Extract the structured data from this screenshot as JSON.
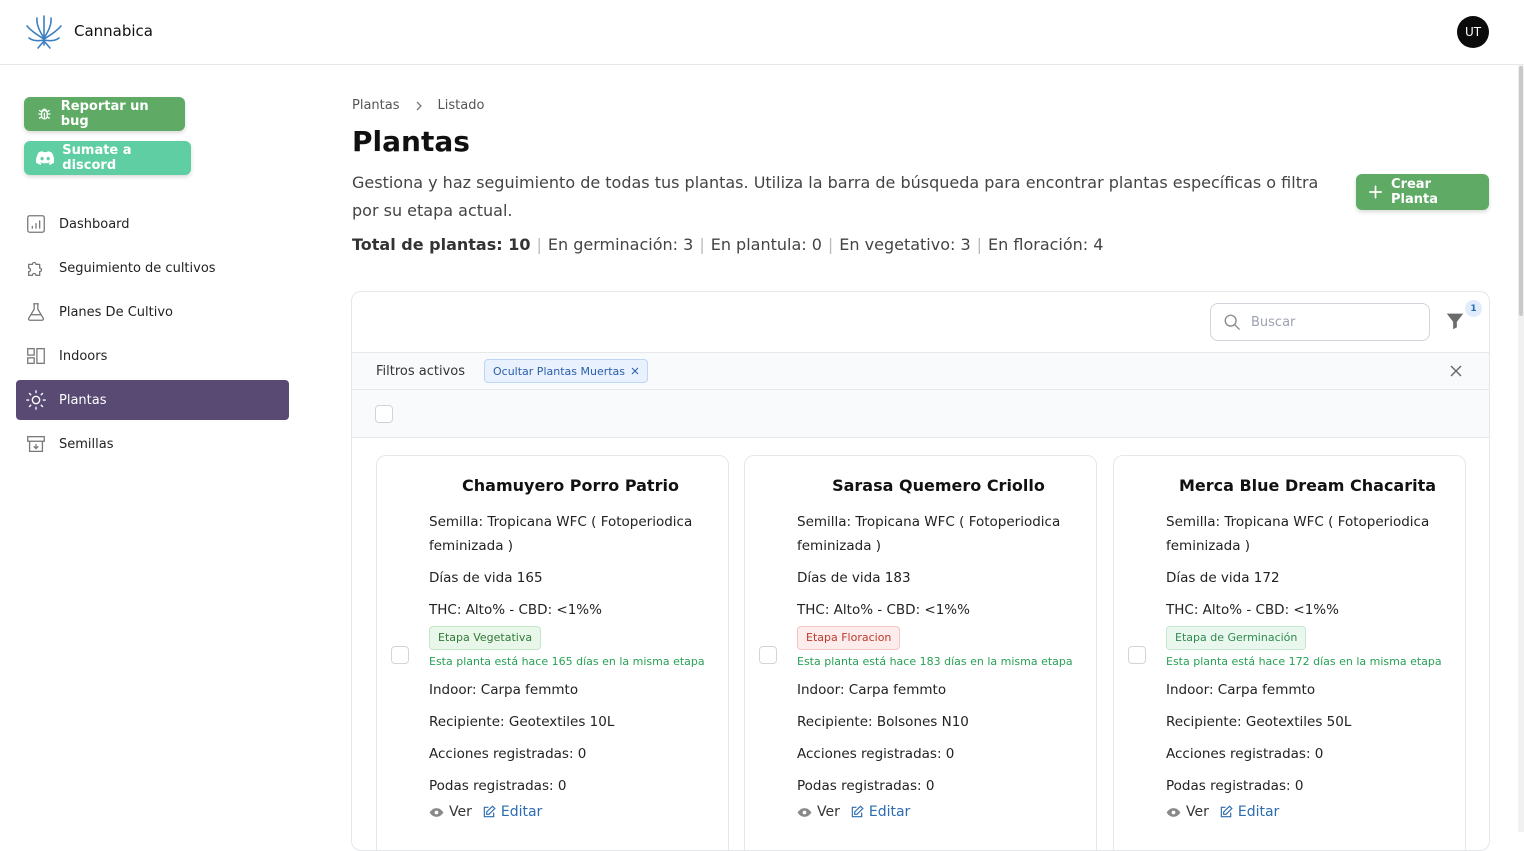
{
  "app": {
    "name": "Cannabica",
    "user_initials": "UT"
  },
  "sidebar": {
    "bug_button": "Reportar un bug",
    "discord_button": "Sumate a discord",
    "items": [
      {
        "label": "Dashboard",
        "icon": "chart-icon"
      },
      {
        "label": "Seguimiento de cultivos",
        "icon": "puzzle-icon"
      },
      {
        "label": "Planes De Cultivo",
        "icon": "flask-icon"
      },
      {
        "label": "Indoors",
        "icon": "layout-icon"
      },
      {
        "label": "Plantas",
        "icon": "sun-icon",
        "active": true
      },
      {
        "label": "Semillas",
        "icon": "archive-icon"
      }
    ]
  },
  "breadcrumb": [
    "Plantas",
    "Listado"
  ],
  "page": {
    "title": "Plantas",
    "description": "Gestiona y haz seguimiento de todas tus plantas. Utiliza la barra de búsqueda para encontrar plantas específicas o filtra por su etapa actual.",
    "create_button": "Crear Planta"
  },
  "stats": {
    "total": "Total de plantas: 10",
    "germination": "En germinación: 3",
    "seedling": "En plantula: 0",
    "vegetative": "En vegetativo: 3",
    "flowering": "En floración: 4"
  },
  "toolbar": {
    "search_placeholder": "Buscar",
    "filter_count": "1",
    "active_filters_label": "Filtros activos",
    "active_filter_chip": "Ocultar Plantas Muertas"
  },
  "colors": {
    "primary_green": "#5fab66",
    "discord": "#5fcfa3",
    "nav_active": "#584a73"
  },
  "cards": [
    {
      "title": "Chamuyero Porro Patrio",
      "seed": "Semilla: Tropicana WFC ( Fotoperiodica feminizada )",
      "days": "Días de vida 165",
      "thc": "THC: Alto% - CBD: <1%%",
      "stage": "Etapa Vegetativa",
      "stage_note": "Esta planta está hace 165 días en la misma etapa",
      "indoor": "Indoor: Carpa femmto",
      "container": "Recipiente: Geotextiles 10L",
      "actions_count": "Acciones registradas: 0",
      "prunes": "Podas registradas: 0",
      "view": "Ver",
      "edit": "Editar"
    },
    {
      "title": "Sarasa Quemero Criollo",
      "seed": "Semilla: Tropicana WFC ( Fotoperiodica feminizada )",
      "days": "Días de vida 183",
      "thc": "THC: Alto% - CBD: <1%%",
      "stage": "Etapa Floracion",
      "stage_note": "Esta planta está hace 183 días en la misma etapa",
      "indoor": "Indoor: Carpa femmto",
      "container": "Recipiente: Bolsones N10",
      "actions_count": "Acciones registradas: 0",
      "prunes": "Podas registradas: 0",
      "view": "Ver",
      "edit": "Editar"
    },
    {
      "title": "Merca Blue Dream Chacarita",
      "seed": "Semilla: Tropicana WFC ( Fotoperiodica feminizada )",
      "days": "Días de vida 172",
      "thc": "THC: Alto% - CBD: <1%%",
      "stage": "Etapa de Germinación",
      "stage_note": "Esta planta está hace 172 días en la misma etapa",
      "indoor": "Indoor: Carpa femmto",
      "container": "Recipiente: Geotextiles 50L",
      "actions_count": "Acciones registradas: 0",
      "prunes": "Podas registradas: 0",
      "view": "Ver",
      "edit": "Editar"
    }
  ]
}
